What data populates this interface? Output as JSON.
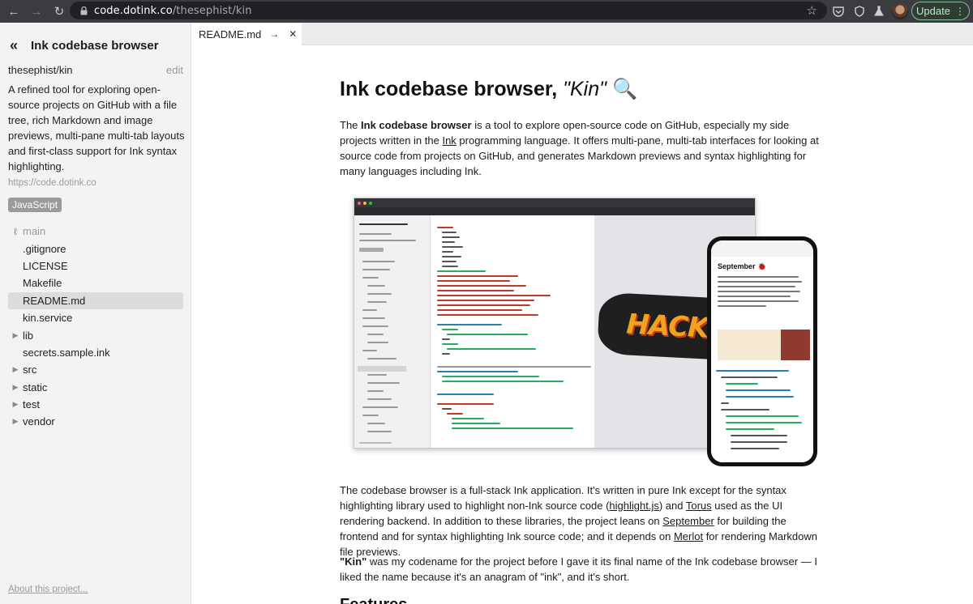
{
  "browser": {
    "url_host": "code.dotink.co",
    "url_path": "/thesephist/kin",
    "update_label": "Update"
  },
  "icons": {
    "back": "arrow-left-icon",
    "forward": "arrow-right-icon",
    "reload": "reload-icon",
    "lock": "lock-icon",
    "bookmark": "star-icon",
    "extensions": [
      "pocket-icon",
      "shield-icon",
      "flask-icon"
    ],
    "collapse": "double-chevron-left-icon",
    "branch": "git-branch-icon"
  },
  "sidebar": {
    "title": "Ink codebase browser",
    "repo": "thesephist/kin",
    "edit_label": "edit",
    "description": "A refined tool for exploring open-source projects on GitHub with a file tree, rich Markdown and image previews, multi-pane multi-tab layouts and first-class support for Ink syntax highlighting.",
    "website": "https://code.dotink.co",
    "language_badge": "JavaScript",
    "branch": "main",
    "tree": [
      {
        "name": ".gitignore",
        "type": "file"
      },
      {
        "name": "LICENSE",
        "type": "file"
      },
      {
        "name": "Makefile",
        "type": "file"
      },
      {
        "name": "README.md",
        "type": "file",
        "active": true
      },
      {
        "name": "kin.service",
        "type": "file"
      },
      {
        "name": "lib",
        "type": "folder"
      },
      {
        "name": "secrets.sample.ink",
        "type": "file"
      },
      {
        "name": "src",
        "type": "folder"
      },
      {
        "name": "static",
        "type": "folder"
      },
      {
        "name": "test",
        "type": "folder"
      },
      {
        "name": "vendor",
        "type": "folder"
      }
    ],
    "about_link": "About this project..."
  },
  "tabs": [
    {
      "label": "README.md",
      "active": true
    }
  ],
  "article": {
    "title": "Ink codebase browser, ",
    "title_italic": "\"Kin\"",
    "title_emoji": "🔍",
    "p1": {
      "a": "The ",
      "b": "Ink codebase browser",
      "c": " is a tool to explore open-source code on GitHub, especially my side projects written in the ",
      "d": "Ink",
      "e": " programming language. It offers multi-pane, multi-tab interfaces for looking at source code from projects on GitHub, and generates Markdown previews and syntax highlighting for many languages including Ink."
    },
    "p2": {
      "a": "The codebase browser is a full-stack Ink application. It's written in pure Ink except for the syntax highlighting library used to highlight non-Ink source code (",
      "b": "highlight.js",
      "c": ") and ",
      "d": "Torus",
      "e": " used as the UI rendering backend. In addition to these libraries, the project leans on ",
      "f": "September",
      "g": " for building the frontend and for syntax highlighting Ink source code; and it depends on ",
      "h": "Merlot",
      "i": " for rendering Markdown file previews."
    },
    "p3": {
      "a": "\"Kin\"",
      "b": " was my codename for the project before I gave it its final name of the Ink codebase browser — I liked the name because it's an anagram of \"ink\", and it's short."
    },
    "next_heading": "Features",
    "screenshot": {
      "sticker_text": "HACK",
      "phone_title": "September 🐞"
    }
  }
}
